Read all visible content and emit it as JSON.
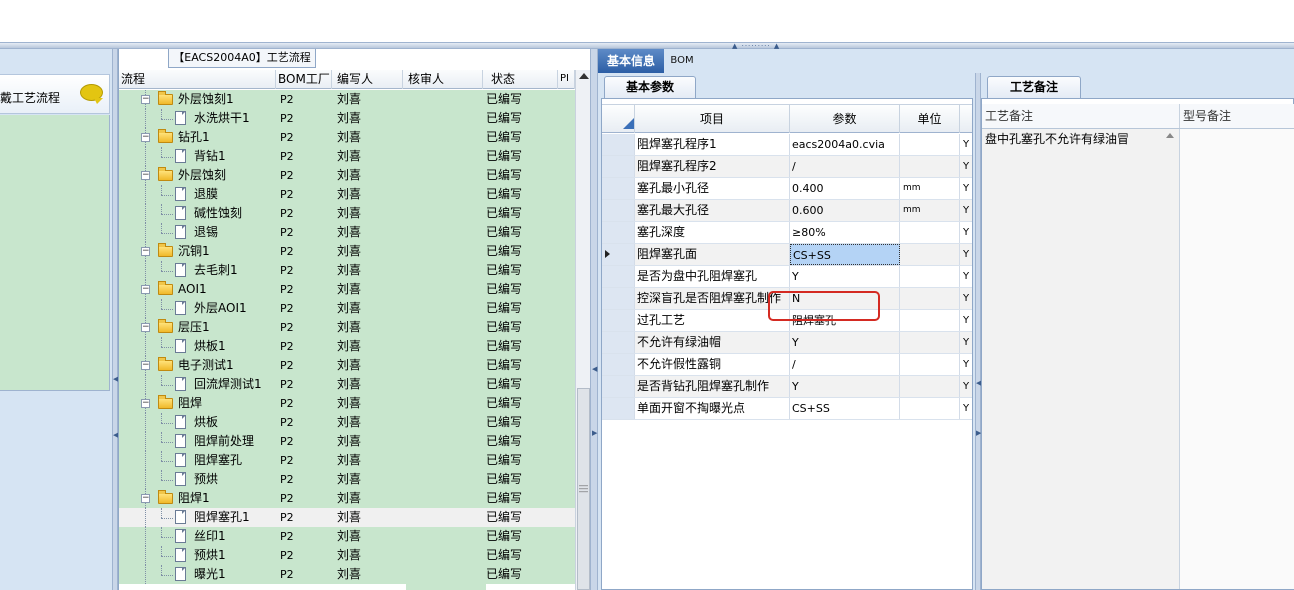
{
  "tree_panel": {
    "title": "【EACS2004A0】工艺流程",
    "columns": [
      "流程",
      "BOM工厂",
      "编写人",
      "核审人",
      "状态",
      "PI"
    ],
    "rows": [
      {
        "name": "外层蚀刻1",
        "level": 1,
        "type": "folder",
        "bom": "P2",
        "author": "刘喜",
        "reviewer": "",
        "status": "已编写"
      },
      {
        "name": "水洗烘干1",
        "level": 2,
        "type": "doc",
        "bom": "P2",
        "author": "刘喜",
        "reviewer": "",
        "status": "已编写"
      },
      {
        "name": "钻孔1",
        "level": 1,
        "type": "folder",
        "bom": "P2",
        "author": "刘喜",
        "reviewer": "",
        "status": "已编写"
      },
      {
        "name": "背钻1",
        "level": 2,
        "type": "doc",
        "bom": "P2",
        "author": "刘喜",
        "reviewer": "",
        "status": "已编写"
      },
      {
        "name": "外层蚀刻",
        "level": 1,
        "type": "folder",
        "bom": "P2",
        "author": "刘喜",
        "reviewer": "",
        "status": "已编写"
      },
      {
        "name": "退膜",
        "level": 2,
        "type": "doc",
        "bom": "P2",
        "author": "刘喜",
        "reviewer": "",
        "status": "已编写"
      },
      {
        "name": "碱性蚀刻",
        "level": 2,
        "type": "doc",
        "bom": "P2",
        "author": "刘喜",
        "reviewer": "",
        "status": "已编写"
      },
      {
        "name": "退锡",
        "level": 2,
        "type": "doc",
        "bom": "P2",
        "author": "刘喜",
        "reviewer": "",
        "status": "已编写"
      },
      {
        "name": "沉铜1",
        "level": 1,
        "type": "folder",
        "bom": "P2",
        "author": "刘喜",
        "reviewer": "",
        "status": "已编写"
      },
      {
        "name": "去毛刺1",
        "level": 2,
        "type": "doc",
        "bom": "P2",
        "author": "刘喜",
        "reviewer": "",
        "status": "已编写"
      },
      {
        "name": "AOI1",
        "level": 1,
        "type": "folder",
        "bom": "P2",
        "author": "刘喜",
        "reviewer": "",
        "status": "已编写"
      },
      {
        "name": "外层AOI1",
        "level": 2,
        "type": "doc",
        "bom": "P2",
        "author": "刘喜",
        "reviewer": "",
        "status": "已编写"
      },
      {
        "name": "层压1",
        "level": 1,
        "type": "folder",
        "bom": "P2",
        "author": "刘喜",
        "reviewer": "",
        "status": "已编写"
      },
      {
        "name": "烘板1",
        "level": 2,
        "type": "doc",
        "bom": "P2",
        "author": "刘喜",
        "reviewer": "",
        "status": "已编写"
      },
      {
        "name": "电子测试1",
        "level": 1,
        "type": "folder",
        "bom": "P2",
        "author": "刘喜",
        "reviewer": "",
        "status": "已编写"
      },
      {
        "name": "回流焊测试1",
        "level": 2,
        "type": "doc",
        "bom": "P2",
        "author": "刘喜",
        "reviewer": "",
        "status": "已编写"
      },
      {
        "name": "阻焊",
        "level": 1,
        "type": "folder",
        "bom": "P2",
        "author": "刘喜",
        "reviewer": "",
        "status": "已编写"
      },
      {
        "name": "烘板",
        "level": 2,
        "type": "doc",
        "bom": "P2",
        "author": "刘喜",
        "reviewer": "",
        "status": "已编写"
      },
      {
        "name": "阻焊前处理",
        "level": 2,
        "type": "doc",
        "bom": "P2",
        "author": "刘喜",
        "reviewer": "",
        "status": "已编写"
      },
      {
        "name": "阻焊塞孔",
        "level": 2,
        "type": "doc",
        "bom": "P2",
        "author": "刘喜",
        "reviewer": "",
        "status": "已编写"
      },
      {
        "name": "预烘",
        "level": 2,
        "type": "doc",
        "bom": "P2",
        "author": "刘喜",
        "reviewer": "",
        "status": "已编写"
      },
      {
        "name": "阻焊1",
        "level": 1,
        "type": "folder",
        "bom": "P2",
        "author": "刘喜",
        "reviewer": "",
        "status": "已编写"
      },
      {
        "name": "阻焊塞孔1",
        "level": 2,
        "type": "doc",
        "bom": "P2",
        "author": "刘喜",
        "reviewer": "",
        "status": "已编写",
        "selected": true
      },
      {
        "name": "丝印1",
        "level": 2,
        "type": "doc",
        "bom": "P2",
        "author": "刘喜",
        "reviewer": "",
        "status": "已编写"
      },
      {
        "name": "预烘1",
        "level": 2,
        "type": "doc",
        "bom": "P2",
        "author": "刘喜",
        "reviewer": "",
        "status": "已编写"
      },
      {
        "name": "曝光1",
        "level": 2,
        "type": "doc",
        "bom": "P2",
        "author": "刘喜",
        "reviewer": "",
        "status": "已编写"
      }
    ]
  },
  "left_panel": {
    "label": "戴工艺流程"
  },
  "right": {
    "tabs": [
      "基本信息",
      "BOM"
    ],
    "active_tab": "基本信息",
    "params": {
      "tab_label": "基本参数",
      "columns": [
        "项目",
        "参数",
        "单位"
      ],
      "rows": [
        {
          "item": "阻焊塞孔程序1",
          "value": "eacs2004a0.cvia",
          "unit": "",
          "flag": "Y"
        },
        {
          "item": "阻焊塞孔程序2",
          "value": "/",
          "unit": "",
          "flag": "Y"
        },
        {
          "item": "塞孔最小孔径",
          "value": "0.400",
          "unit": "mm",
          "flag": "Y"
        },
        {
          "item": "塞孔最大孔径",
          "value": "0.600",
          "unit": "mm",
          "flag": "Y"
        },
        {
          "item": "塞孔深度",
          "value": "≥80%",
          "unit": "",
          "flag": "Y"
        },
        {
          "item": "阻焊塞孔面",
          "value": "CS+SS",
          "unit": "",
          "flag": "Y",
          "current": true
        },
        {
          "item": "是否为盘中孔阻焊塞孔",
          "value": "Y",
          "unit": "",
          "flag": "Y"
        },
        {
          "item": "控深盲孔是否阻焊塞孔制作",
          "value": "N",
          "unit": "",
          "flag": "Y"
        },
        {
          "item": "过孔工艺",
          "value": "阻焊塞孔",
          "unit": "",
          "flag": "Y"
        },
        {
          "item": "不允许有绿油帽",
          "value": "Y",
          "unit": "",
          "flag": "Y"
        },
        {
          "item": "不允许假性露铜",
          "value": "/",
          "unit": "",
          "flag": "Y"
        },
        {
          "item": "是否背钻孔阻焊塞孔制作",
          "value": "Y",
          "unit": "",
          "flag": "Y"
        },
        {
          "item": "单面开窗不掏曝光点",
          "value": "CS+SS",
          "unit": "",
          "flag": "Y"
        }
      ]
    },
    "notes": {
      "tab_label": "工艺备注",
      "columns": [
        "工艺备注",
        "型号备注"
      ],
      "process_note": "盘中孔塞孔不允许有绿油冒",
      "model_note": ""
    }
  },
  "colors": {
    "row_green": "#c8e6cd",
    "tab_active": "#2c5ea5",
    "panel_blue": "#d6e4f3",
    "highlight_red": "#d42a22",
    "cell_selected": "#b4d3f5"
  }
}
